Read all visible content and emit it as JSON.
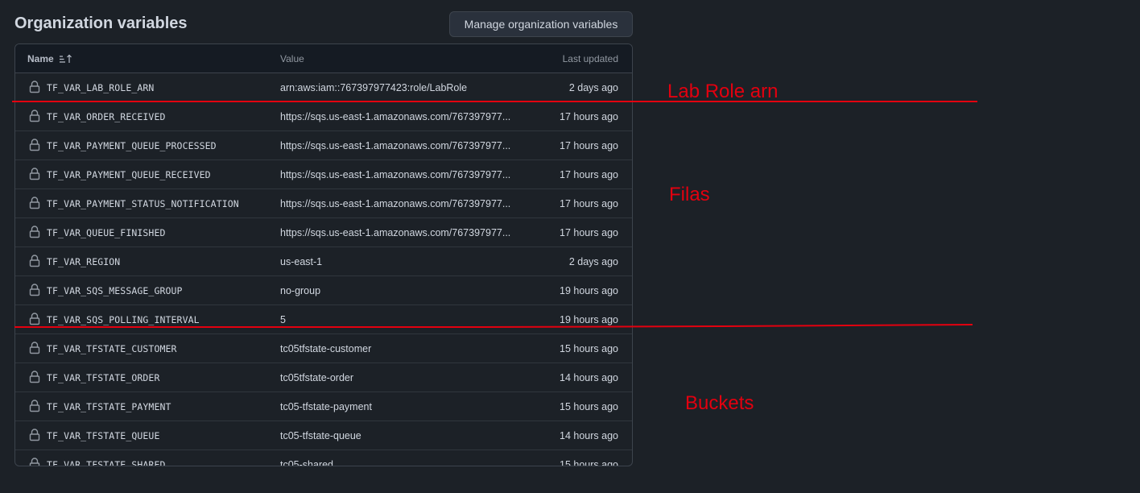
{
  "header": {
    "title": "Organization variables",
    "manage_button_label": "Manage organization variables"
  },
  "table": {
    "columns": {
      "name": "Name",
      "value": "Value",
      "updated": "Last updated"
    },
    "rows": [
      {
        "name": "TF_VAR_LAB_ROLE_ARN",
        "value": "arn:aws:iam::767397977423:role/LabRole",
        "updated": "2 days ago"
      },
      {
        "name": "TF_VAR_ORDER_RECEIVED",
        "value": "https://sqs.us-east-1.amazonaws.com/767397977...",
        "updated": "17 hours ago"
      },
      {
        "name": "TF_VAR_PAYMENT_QUEUE_PROCESSED",
        "value": "https://sqs.us-east-1.amazonaws.com/767397977...",
        "updated": "17 hours ago"
      },
      {
        "name": "TF_VAR_PAYMENT_QUEUE_RECEIVED",
        "value": "https://sqs.us-east-1.amazonaws.com/767397977...",
        "updated": "17 hours ago"
      },
      {
        "name": "TF_VAR_PAYMENT_STATUS_NOTIFICATION",
        "value": "https://sqs.us-east-1.amazonaws.com/767397977...",
        "updated": "17 hours ago"
      },
      {
        "name": "TF_VAR_QUEUE_FINISHED",
        "value": "https://sqs.us-east-1.amazonaws.com/767397977...",
        "updated": "17 hours ago"
      },
      {
        "name": "TF_VAR_REGION",
        "value": "us-east-1",
        "updated": "2 days ago"
      },
      {
        "name": "TF_VAR_SQS_MESSAGE_GROUP",
        "value": "no-group",
        "updated": "19 hours ago"
      },
      {
        "name": "TF_VAR_SQS_POLLING_INTERVAL",
        "value": "5",
        "updated": "19 hours ago"
      },
      {
        "name": "TF_VAR_TFSTATE_CUSTOMER",
        "value": "tc05tfstate-customer",
        "updated": "15 hours ago"
      },
      {
        "name": "TF_VAR_TFSTATE_ORDER",
        "value": "tc05tfstate-order",
        "updated": "14 hours ago"
      },
      {
        "name": "TF_VAR_TFSTATE_PAYMENT",
        "value": "tc05-tfstate-payment",
        "updated": "15 hours ago"
      },
      {
        "name": "TF_VAR_TFSTATE_QUEUE",
        "value": "tc05-tfstate-queue",
        "updated": "14 hours ago"
      },
      {
        "name": "TF_VAR_TFSTATE_SHARED",
        "value": "tc05-shared",
        "updated": "15 hours ago"
      }
    ]
  },
  "annotations": {
    "lab_role": "Lab Role arn",
    "filas": "Filas",
    "buckets": "Buckets",
    "color": "#e3000f"
  },
  "icons": {
    "row_icon": "lock-icon",
    "sort_icon": "sort-ascending-icon"
  }
}
